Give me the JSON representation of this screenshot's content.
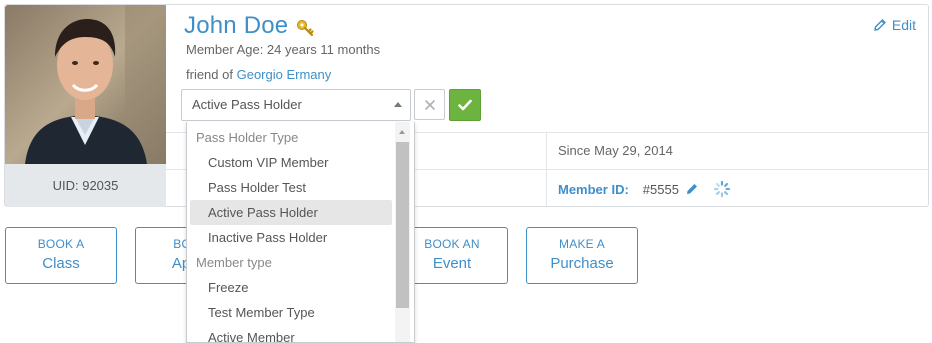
{
  "profile": {
    "name": "John Doe",
    "member_age": "Member Age: 24 years 11 months",
    "friend_prefix": "friend of",
    "friend_name": "Georgio Ermany",
    "uid": "UID: 92035",
    "edit_label": "Edit",
    "since": "Since May 29, 2014",
    "member_id_label": "Member ID:",
    "member_id_value": "#5555"
  },
  "status_select": {
    "selected": "Active Pass Holder",
    "options": [
      {
        "type": "group",
        "label": "Pass Holder Type"
      },
      {
        "type": "item",
        "label": "Custom VIP Member"
      },
      {
        "type": "item",
        "label": "Pass Holder Test"
      },
      {
        "type": "item",
        "label": "Active Pass Holder",
        "selected": true
      },
      {
        "type": "item",
        "label": "Inactive Pass Holder"
      },
      {
        "type": "group",
        "label": "Member type"
      },
      {
        "type": "item",
        "label": "Freeze"
      },
      {
        "type": "item",
        "label": "Test Member Type"
      },
      {
        "type": "item",
        "label": "Active Member"
      }
    ]
  },
  "actions": [
    {
      "line1": "BOOK A",
      "line2": "Class"
    },
    {
      "line1": "BOOK",
      "line2": "Appoi"
    },
    {
      "line1": "BOOK AN",
      "line2": "Event"
    },
    {
      "line1": "MAKE A",
      "line2": "Purchase"
    }
  ],
  "colors": {
    "accent": "#3f8fc9",
    "confirm": "#6cb33f",
    "uid_bg": "#e4e8eb"
  },
  "icons": {
    "key": "key-icon",
    "edit": "pencil-icon",
    "cancel": "close-icon",
    "confirm": "check-icon",
    "loading": "spinner-icon"
  }
}
